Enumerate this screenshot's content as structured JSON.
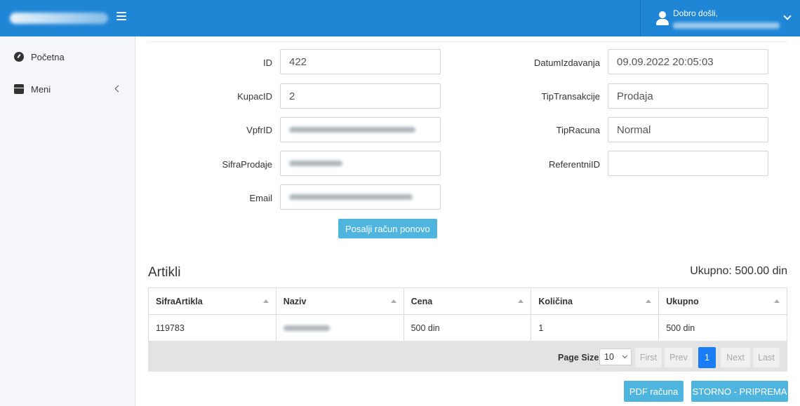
{
  "header": {
    "greeting": "Dobro došli,"
  },
  "sidebar": {
    "items": [
      {
        "label": "Početna",
        "icon": "dashboard-icon"
      },
      {
        "label": "Meni",
        "icon": "box-icon"
      }
    ]
  },
  "form": {
    "left": [
      {
        "label": "ID",
        "value": "422"
      },
      {
        "label": "KupacID",
        "value": "2"
      },
      {
        "label": "VpfrID",
        "value": ""
      },
      {
        "label": "SifraProdaje",
        "value": ""
      },
      {
        "label": "Email",
        "value": ""
      }
    ],
    "right": [
      {
        "label": "DatumIzdavanja",
        "value": "09.09.2022 20:05:03"
      },
      {
        "label": "TipTransakcije",
        "value": "Prodaja"
      },
      {
        "label": "TipRacuna",
        "value": "Normal"
      },
      {
        "label": "ReferentniID",
        "value": ""
      }
    ],
    "resend_button": "Posalji račun ponovo"
  },
  "articles": {
    "title": "Artikli",
    "total": "Ukupno: 500.00 din",
    "columns": [
      "SifraArtikla",
      "Naziv",
      "Cena",
      "Količina",
      "Ukupno"
    ],
    "rows": [
      {
        "sifra": "119783",
        "naziv": "",
        "cena": "500 din",
        "kolicina": "1",
        "ukupno": "500 din"
      }
    ]
  },
  "pager": {
    "page_size_label": "Page Size",
    "page_size_value": "10",
    "first": "First",
    "prev": "Prev",
    "current": "1",
    "next": "Next",
    "last": "Last"
  },
  "actions": {
    "pdf": "PDF računa",
    "storno": "STORNO - PRIPREMA"
  },
  "colors": {
    "header_bg": "#1f86d6",
    "button": "#4fb4de",
    "active_page": "#1a7cf5"
  }
}
